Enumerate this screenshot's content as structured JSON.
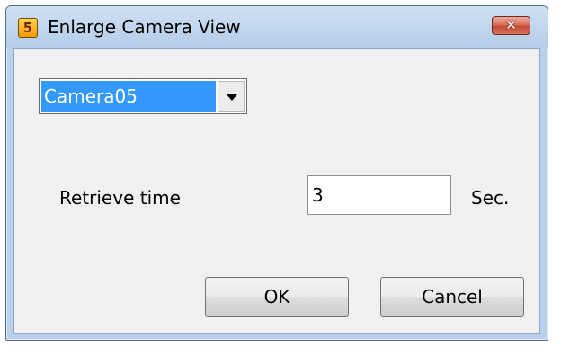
{
  "window": {
    "title": "Enlarge Camera View",
    "app_icon": "app-icon",
    "app_icon_glyph": "5",
    "close_glyph": "✕"
  },
  "camera_select": {
    "selected": "Camera05",
    "arrow_icon": "chevron-down-icon"
  },
  "retrieve": {
    "label": "Retrieve time",
    "value": "3",
    "unit": "Sec."
  },
  "buttons": {
    "ok": "OK",
    "cancel": "Cancel"
  },
  "colors": {
    "titlebar": "#b9d1ea",
    "selection": "#3399ff",
    "close": "#c44a33",
    "client": "#f0f0f0"
  }
}
